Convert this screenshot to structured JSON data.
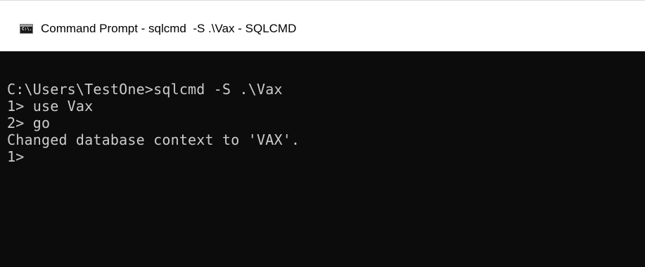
{
  "window": {
    "title": "Command Prompt - sqlcmd  -S .\\Vax - SQLCMD",
    "icon": "cmd-console-icon",
    "icon_glyph": "C:\\."
  },
  "console": {
    "lines": [
      "C:\\Users\\TestOne>sqlcmd -S .\\Vax",
      "1> use Vax",
      "2> go",
      "Changed database context to 'VAX'.",
      "1>"
    ],
    "text_color": "#cccccc",
    "background_color": "#0c0c0c"
  }
}
